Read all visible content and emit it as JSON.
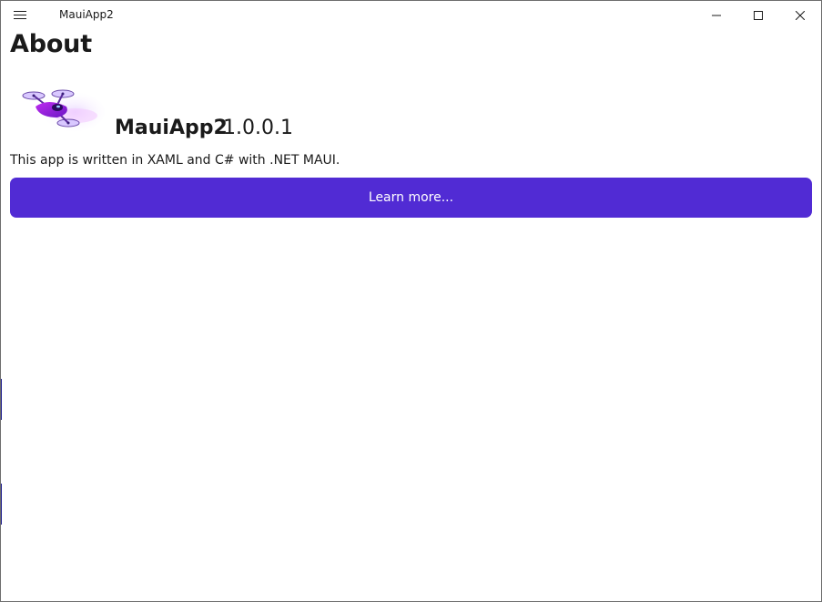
{
  "window": {
    "title": "MauiApp2",
    "menu_icon": "hamburger-menu-icon",
    "controls": [
      "minimize-icon",
      "maximize-icon",
      "close-icon"
    ]
  },
  "page": {
    "title": "About"
  },
  "app_info": {
    "logo_icon": "dotnet-bot-logo",
    "name": "MauiApp2",
    "version": "1.0.0.1",
    "description": "This app is written in XAML and C# with .NET MAUI."
  },
  "actions": {
    "learn_more_label": "Learn more..."
  },
  "colors": {
    "accent": "#512BD4",
    "button_text": "#FFFFFF",
    "text": "#1A1A1A",
    "window_border": "#6E6E6E"
  }
}
